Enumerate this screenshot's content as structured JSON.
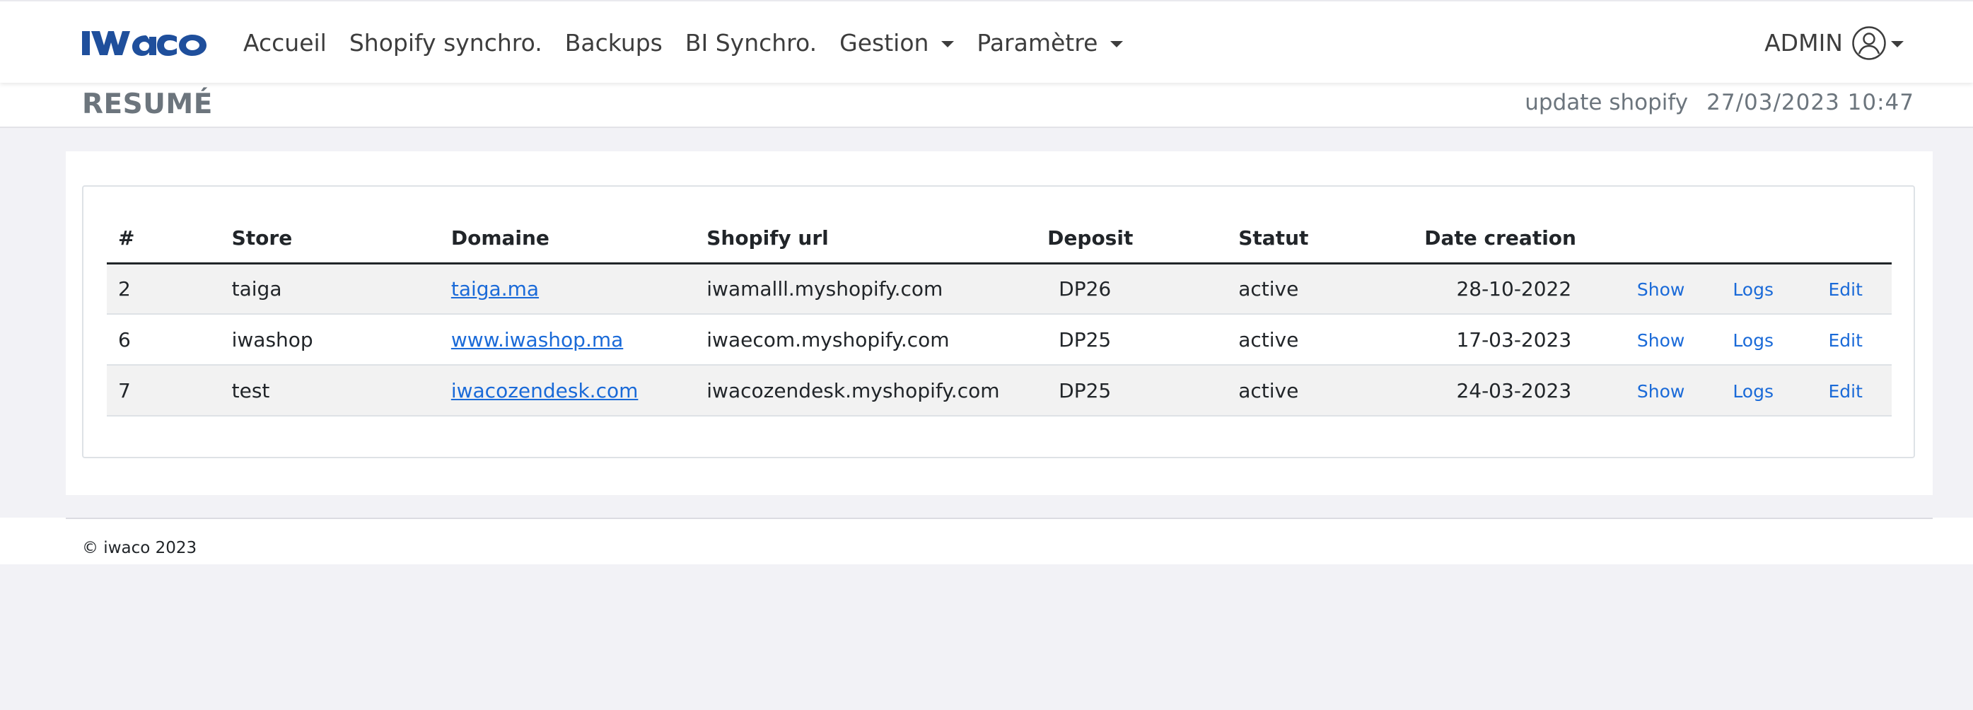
{
  "brand": {
    "logo_text": "IWACO",
    "color": "#1f4f9c"
  },
  "nav": {
    "items": [
      {
        "label": "Accueil",
        "dropdown": false
      },
      {
        "label": "Shopify synchro.",
        "dropdown": false
      },
      {
        "label": "Backups",
        "dropdown": false
      },
      {
        "label": "BI Synchro.",
        "dropdown": false
      },
      {
        "label": "Gestion",
        "dropdown": true
      },
      {
        "label": "Paramètre",
        "dropdown": true
      }
    ],
    "user_label": "ADMIN",
    "user_icon": "user-circle-icon"
  },
  "header": {
    "title": "RESUMÉ",
    "update_label": "update shopify",
    "update_date": "27/03/2023 10:47"
  },
  "table": {
    "columns": [
      "#",
      "Store",
      "Domaine",
      "Shopify url",
      "Deposit",
      "Statut",
      "Date creation"
    ],
    "rows": [
      {
        "id": "2",
        "store": "taiga",
        "domain": "taiga.ma",
        "shopify_url": "iwamalll.myshopify.com",
        "deposit": "DP26",
        "statut": "active",
        "date": "28-10-2022",
        "show": "Show",
        "logs": "Logs",
        "edit": "Edit"
      },
      {
        "id": "6",
        "store": "iwashop",
        "domain": "www.iwashop.ma",
        "shopify_url": "iwaecom.myshopify.com",
        "deposit": "DP25",
        "statut": "active",
        "date": "17-03-2023",
        "show": "Show",
        "logs": "Logs",
        "edit": "Edit"
      },
      {
        "id": "7",
        "store": "test",
        "domain": "iwacozendesk.com",
        "shopify_url": "iwacozendesk.myshopify.com",
        "deposit": "DP25",
        "statut": "active",
        "date": "24-03-2023",
        "show": "Show",
        "logs": "Logs",
        "edit": "Edit"
      }
    ]
  },
  "footer": {
    "text": "© iwaco 2023"
  },
  "colors": {
    "link": "#1a6ad8",
    "muted": "#6c757d",
    "background": "#f2f2f6"
  }
}
